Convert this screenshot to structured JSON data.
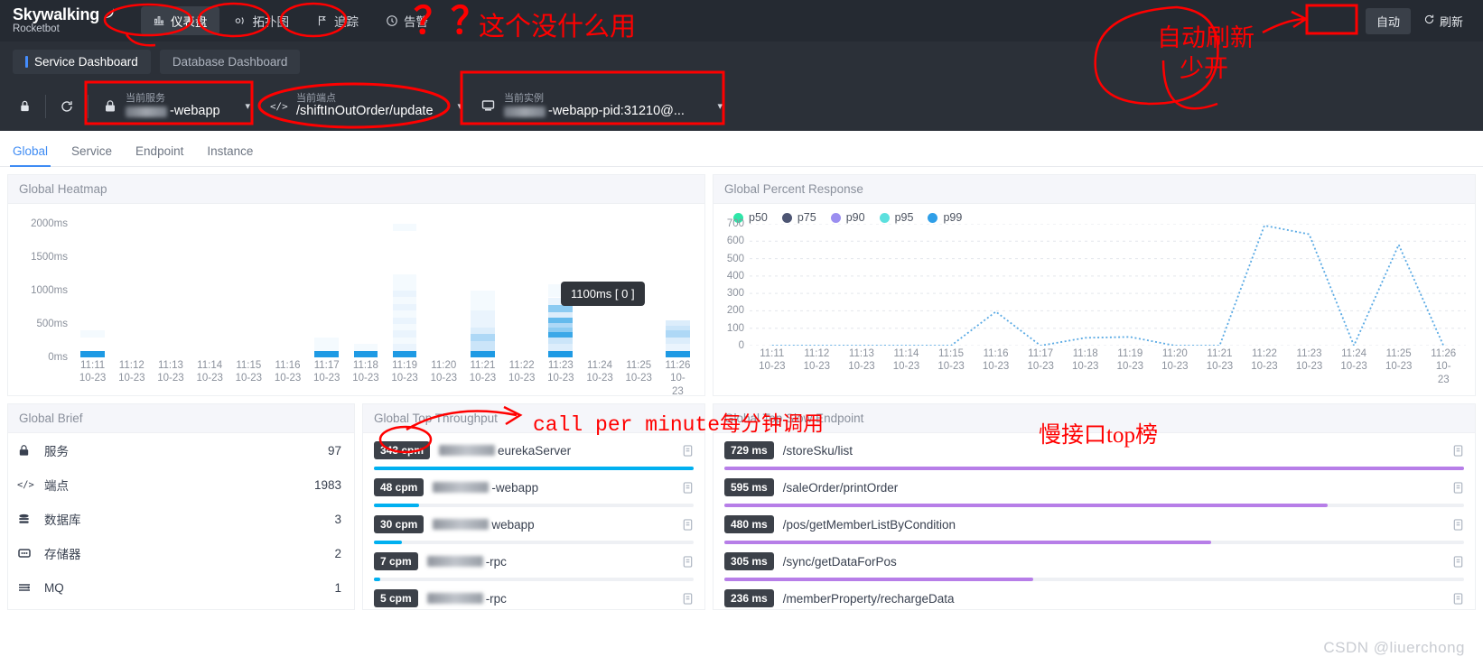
{
  "header": {
    "brand_name": "Skywalking",
    "brand_sub": "Rocketbot",
    "nav": [
      {
        "label": "仪表盘",
        "icon": "dashboard-icon",
        "active": true
      },
      {
        "label": "拓扑图",
        "icon": "topology-icon",
        "active": false
      },
      {
        "label": "追踪",
        "icon": "trace-icon",
        "active": false
      },
      {
        "label": "告警",
        "icon": "alarm-icon",
        "active": false
      }
    ],
    "auto_label": "自动",
    "refresh_label": "刷新",
    "refresh_icon": "refresh-icon"
  },
  "dashboard_tabs": [
    {
      "label": "Service Dashboard",
      "selected": true
    },
    {
      "label": "Database Dashboard",
      "selected": false
    }
  ],
  "toolbar": {
    "lock_icon": "lock-icon",
    "reload_icon": "reload-icon",
    "selectors": [
      {
        "label": "当前服务",
        "value": "-webapp",
        "redacted": true,
        "icon": "service-icon"
      },
      {
        "label": "当前端点",
        "value": "/shiftInOutOrder/update",
        "redacted": false,
        "icon": "code-icon"
      },
      {
        "label": "当前实例",
        "value": "-webapp-pid:31210@...",
        "redacted": true,
        "icon": "instance-icon"
      }
    ]
  },
  "subnav": [
    {
      "label": "Global",
      "active": true
    },
    {
      "label": "Service",
      "active": false
    },
    {
      "label": "Endpoint",
      "active": false
    },
    {
      "label": "Instance",
      "active": false
    }
  ],
  "panels": {
    "heatmap_title": "Global Heatmap",
    "percent_title": "Global Percent Response",
    "brief_title": "Global Brief",
    "throughput_title": "Global Top Throughput",
    "slow_title": "Global Top Slow Endpoint"
  },
  "global_brief": {
    "rows": [
      {
        "icon": "service-icon",
        "label": "服务",
        "value": "97"
      },
      {
        "icon": "code-icon",
        "label": "端点",
        "value": "1983"
      },
      {
        "icon": "database-icon",
        "label": "数据库",
        "value": "3"
      },
      {
        "icon": "cache-icon",
        "label": "存储器",
        "value": "2"
      },
      {
        "icon": "mq-icon",
        "label": "MQ",
        "value": "1"
      }
    ]
  },
  "top_throughput": {
    "unit": "cpm",
    "bar_color": "#00b0f0",
    "rows": [
      {
        "value": "343 cpm",
        "name": "eurekaServer",
        "redacted": true,
        "pct": 100
      },
      {
        "value": "48 cpm",
        "name": "-webapp",
        "redacted": true,
        "pct": 14
      },
      {
        "value": "30 cpm",
        "name": " webapp",
        "redacted": true,
        "pct": 8.7
      },
      {
        "value": "7 cpm",
        "name": "-rpc",
        "redacted": true,
        "pct": 2.0
      },
      {
        "value": "5 cpm",
        "name": "-rpc",
        "redacted": true,
        "pct": 1.5
      }
    ]
  },
  "top_slow_endpoint": {
    "unit": "ms",
    "bar_color": "#b77ee8",
    "rows": [
      {
        "value": "729 ms",
        "name": "/storeSku/list",
        "pct": 100
      },
      {
        "value": "595 ms",
        "name": "/saleOrder/printOrder",
        "pct": 81.6
      },
      {
        "value": "480 ms",
        "name": "/pos/getMemberListByCondition",
        "pct": 65.8
      },
      {
        "value": "305 ms",
        "name": "/sync/getDataForPos",
        "pct": 41.8
      },
      {
        "value": "236 ms",
        "name": "/memberProperty/rechargeData",
        "pct": 32.4
      }
    ]
  },
  "annotations": {
    "alarm_useless": "这个没什么用",
    "question_marks": "？？",
    "auto_refresh_note_line1": "自动刷新",
    "auto_refresh_note_line2": "少开",
    "cpm_note": "call per minute每分钟调用",
    "slow_note": "慢接口top榜"
  },
  "watermark": "CSDN @liuerchong",
  "chart_data": [
    {
      "type": "heatmap",
      "title": "Global Heatmap",
      "xlabel": "",
      "ylabel": "",
      "ylim": [
        0,
        2300
      ],
      "ytick_labels": [
        "0ms",
        "500ms",
        "1000ms",
        "1500ms",
        "2000ms"
      ],
      "ytick_values": [
        0,
        500,
        1000,
        1500,
        2000
      ],
      "x": [
        "11:11",
        "11:12",
        "11:13",
        "11:14",
        "11:15",
        "11:16",
        "11:17",
        "11:18",
        "11:19",
        "11:20",
        "11:21",
        "11:22",
        "11:23",
        "11:24",
        "11:25",
        "11:26"
      ],
      "x_sub": "10-23",
      "tooltip": "1100ms [ 0 ]",
      "grid": false,
      "columns": [
        {
          "x": "11:11",
          "cells": [
            {
              "y0": 0,
              "y1": 100,
              "v": 9
            },
            {
              "y0": 300,
              "y1": 400,
              "v": 1
            }
          ]
        },
        {
          "x": "11:12",
          "cells": []
        },
        {
          "x": "11:13",
          "cells": []
        },
        {
          "x": "11:14",
          "cells": []
        },
        {
          "x": "11:15",
          "cells": []
        },
        {
          "x": "11:16",
          "cells": []
        },
        {
          "x": "11:17",
          "cells": [
            {
              "y0": 0,
              "y1": 100,
              "v": 9
            },
            {
              "y0": 100,
              "y1": 300,
              "v": 1
            }
          ]
        },
        {
          "x": "11:18",
          "cells": [
            {
              "y0": 0,
              "y1": 100,
              "v": 9
            },
            {
              "y0": 100,
              "y1": 200,
              "v": 1
            }
          ]
        },
        {
          "x": "11:19",
          "cells": [
            {
              "y0": 0,
              "y1": 100,
              "v": 9
            },
            {
              "y0": 100,
              "y1": 200,
              "v": 2
            },
            {
              "y0": 200,
              "y1": 300,
              "v": 1
            },
            {
              "y0": 300,
              "y1": 400,
              "v": 2
            },
            {
              "y0": 400,
              "y1": 500,
              "v": 1
            },
            {
              "y0": 500,
              "y1": 600,
              "v": 2
            },
            {
              "y0": 600,
              "y1": 700,
              "v": 1
            },
            {
              "y0": 700,
              "y1": 800,
              "v": 2
            },
            {
              "y0": 800,
              "y1": 900,
              "v": 1
            },
            {
              "y0": 900,
              "y1": 1000,
              "v": 2
            },
            {
              "y0": 1000,
              "y1": 1100,
              "v": 1
            },
            {
              "y0": 1100,
              "y1": 1250,
              "v": 1
            },
            {
              "y0": 1900,
              "y1": 2000,
              "v": 1
            }
          ]
        },
        {
          "x": "11:20",
          "cells": []
        },
        {
          "x": "11:21",
          "cells": [
            {
              "y0": 0,
              "y1": 100,
              "v": 9
            },
            {
              "y0": 100,
              "y1": 250,
              "v": 4
            },
            {
              "y0": 250,
              "y1": 350,
              "v": 5
            },
            {
              "y0": 350,
              "y1": 450,
              "v": 3
            },
            {
              "y0": 450,
              "y1": 550,
              "v": 2
            },
            {
              "y0": 550,
              "y1": 700,
              "v": 2
            },
            {
              "y0": 700,
              "y1": 850,
              "v": 1
            },
            {
              "y0": 850,
              "y1": 1000,
              "v": 1
            }
          ]
        },
        {
          "x": "11:22",
          "cells": []
        },
        {
          "x": "11:23",
          "cells": [
            {
              "y0": 0,
              "y1": 100,
              "v": 9
            },
            {
              "y0": 100,
              "y1": 200,
              "v": 3
            },
            {
              "y0": 200,
              "y1": 300,
              "v": 4
            },
            {
              "y0": 300,
              "y1": 380,
              "v": 8
            },
            {
              "y0": 380,
              "y1": 450,
              "v": 6
            },
            {
              "y0": 450,
              "y1": 520,
              "v": 5
            },
            {
              "y0": 520,
              "y1": 600,
              "v": 7
            },
            {
              "y0": 600,
              "y1": 680,
              "v": 3
            },
            {
              "y0": 680,
              "y1": 780,
              "v": 6
            },
            {
              "y0": 780,
              "y1": 900,
              "v": 2
            },
            {
              "y0": 900,
              "y1": 1000,
              "v": 1
            },
            {
              "y0": 1000,
              "y1": 1100,
              "v": 1
            }
          ]
        },
        {
          "x": "11:24",
          "cells": []
        },
        {
          "x": "11:25",
          "cells": []
        },
        {
          "x": "11:26",
          "cells": [
            {
              "y0": 0,
              "y1": 100,
              "v": 9
            },
            {
              "y0": 100,
              "y1": 200,
              "v": 2
            },
            {
              "y0": 200,
              "y1": 300,
              "v": 3
            },
            {
              "y0": 300,
              "y1": 400,
              "v": 5
            },
            {
              "y0": 400,
              "y1": 480,
              "v": 4
            },
            {
              "y0": 480,
              "y1": 560,
              "v": 3
            }
          ]
        }
      ]
    },
    {
      "type": "line",
      "title": "Global Percent Response",
      "xlabel": "",
      "ylabel": "",
      "ylim": [
        0,
        700
      ],
      "ytick_values": [
        0,
        100,
        200,
        300,
        400,
        500,
        600,
        700
      ],
      "grid": true,
      "legend_position": "top-left",
      "x": [
        "11:11",
        "11:12",
        "11:13",
        "11:14",
        "11:15",
        "11:16",
        "11:17",
        "11:18",
        "11:19",
        "11:20",
        "11:21",
        "11:22",
        "11:23",
        "11:24",
        "11:25",
        "11:26"
      ],
      "x_sub": "10-23",
      "legend": [
        {
          "name": "p50",
          "color": "#2ee6a8"
        },
        {
          "name": "p75",
          "color": "#4d5573"
        },
        {
          "name": "p90",
          "color": "#9b8ef0"
        },
        {
          "name": "p95",
          "color": "#5ce0de"
        },
        {
          "name": "p99",
          "color": "#2f9fe8"
        }
      ],
      "series": [
        {
          "name": "p99",
          "color": "#5aaae4",
          "values": [
            0,
            0,
            0,
            0,
            0,
            195,
            0,
            45,
            50,
            0,
            0,
            690,
            640,
            0,
            580,
            0
          ]
        }
      ]
    }
  ]
}
